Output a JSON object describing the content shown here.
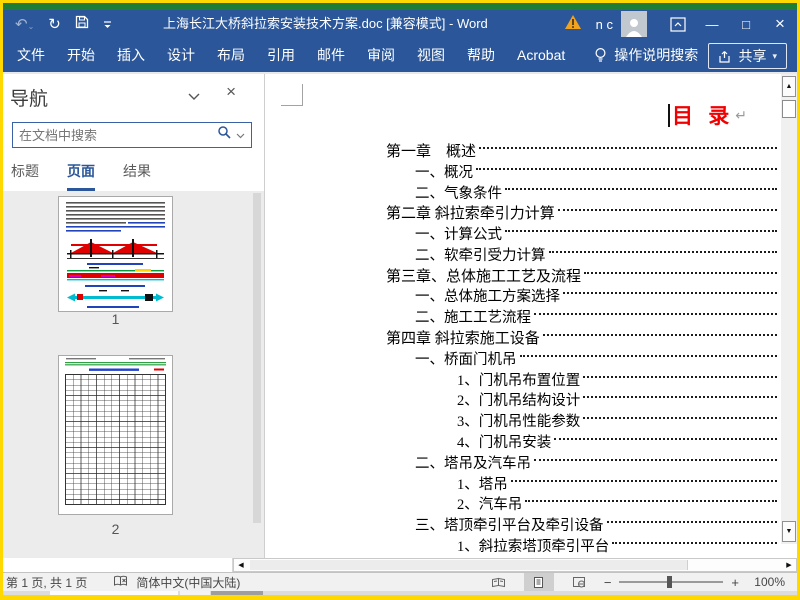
{
  "frame": {
    "border_color": "#ffd800",
    "back_window_color": "#1f7d35"
  },
  "title_bar": {
    "title": "上海长江大桥斜拉索安装技术方案.doc [兼容模式] -  Word",
    "account": "n c"
  },
  "ribbon": {
    "tabs": [
      "文件",
      "开始",
      "插入",
      "设计",
      "布局",
      "引用",
      "邮件",
      "审阅",
      "视图",
      "帮助",
      "Acrobat"
    ],
    "tell_me": "操作说明搜索",
    "share_label": "共享"
  },
  "nav_pane": {
    "title": "导航",
    "search_placeholder": "在文档中搜索",
    "tabs": [
      {
        "label": "标题",
        "active": false
      },
      {
        "label": "页面",
        "active": true
      },
      {
        "label": "结果",
        "active": false
      }
    ],
    "pages": [
      {
        "label": "1"
      },
      {
        "label": "2"
      }
    ]
  },
  "document": {
    "heading": "目 录",
    "paragraph_mark": "↵",
    "toc": [
      {
        "level": 1,
        "text": "第一章　概述"
      },
      {
        "level": 2,
        "text": "一、概况"
      },
      {
        "level": 2,
        "text": "二、气象条件"
      },
      {
        "level": 1,
        "text": "第二章 斜拉索牵引力计算"
      },
      {
        "level": 2,
        "text": "一、计算公式"
      },
      {
        "level": 2,
        "text": "二、软牵引受力计算"
      },
      {
        "level": 1,
        "text": "第三章、总体施工工艺及流程"
      },
      {
        "level": 2,
        "text": "一、总体施工方案选择"
      },
      {
        "level": 2,
        "text": "二、施工工艺流程"
      },
      {
        "level": 1,
        "text": "第四章 斜拉索施工设备"
      },
      {
        "level": 2,
        "text": "一、桥面门机吊"
      },
      {
        "level": 3,
        "text": "1、门机吊布置位置"
      },
      {
        "level": 3,
        "text": "2、门机吊结构设计"
      },
      {
        "level": 3,
        "text": "3、门机吊性能参数"
      },
      {
        "level": 3,
        "text": "4、门机吊安装"
      },
      {
        "level": 2,
        "text": "二、塔吊及汽车吊"
      },
      {
        "level": 3,
        "text": "1、塔吊"
      },
      {
        "level": 3,
        "text": "2、汽车吊"
      },
      {
        "level": 2,
        "text": "三、塔顶牵引平台及牵引设备"
      },
      {
        "level": 3,
        "text": "1、斜拉索塔顶牵引平台"
      }
    ]
  },
  "status_bar": {
    "page_info": "第 1 页, 共 1 页",
    "language": "简体中文(中国大陆)",
    "zoom_level": "100%"
  }
}
